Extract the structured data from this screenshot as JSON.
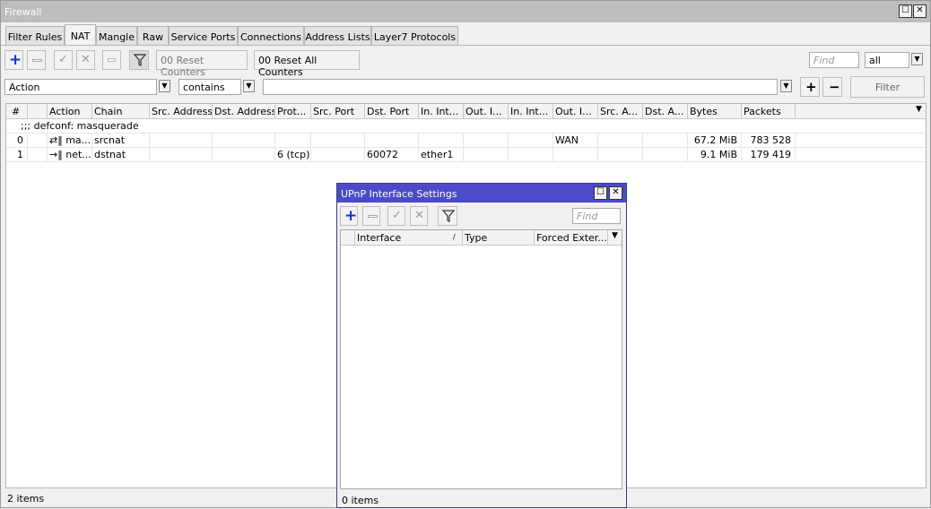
{
  "window": {
    "title": "Firewall"
  },
  "tabs": [
    "Filter Rules",
    "NAT",
    "Mangle",
    "Raw",
    "Service Ports",
    "Connections",
    "Address Lists",
    "Layer7 Protocols"
  ],
  "toolbar": {
    "reset_counters": "00 Reset Counters",
    "reset_all_counters": "00 Reset All Counters",
    "find_placeholder": "Find",
    "scope_value": "all"
  },
  "filter_bar": {
    "field": "Action",
    "operator": "contains",
    "value": "",
    "filter_button": "Filter"
  },
  "table": {
    "columns": [
      "#",
      "",
      "Action",
      "Chain",
      "Src. Address",
      "Dst. Address",
      "Prot...",
      "Src. Port",
      "Dst. Port",
      "In. Int...",
      "Out. I...",
      "In. Int...",
      "Out. I...",
      "Src. A...",
      "Dst. A...",
      "Bytes",
      "Packets"
    ],
    "comment": ";;; defconf: masquerade",
    "rows": [
      {
        "num": "0",
        "action": "ma...",
        "chain": "srcnat",
        "protocol": "",
        "dst_port": "",
        "in_interface": "",
        "out_interface_list": "WAN",
        "bytes": "67.2 MiB",
        "packets": "783 528"
      },
      {
        "num": "1",
        "action": "net...",
        "chain": "dstnat",
        "protocol": "6 (tcp)",
        "dst_port": "60072",
        "in_interface": "ether1",
        "out_interface_list": "",
        "bytes": "9.1 MiB",
        "packets": "179 419"
      }
    ],
    "status": "2 items"
  },
  "upnp": {
    "title": "UPnP Interface Settings",
    "find_placeholder": "Find",
    "columns": [
      "Interface",
      "Type",
      "Forced Exter..."
    ],
    "status": "0 items"
  }
}
